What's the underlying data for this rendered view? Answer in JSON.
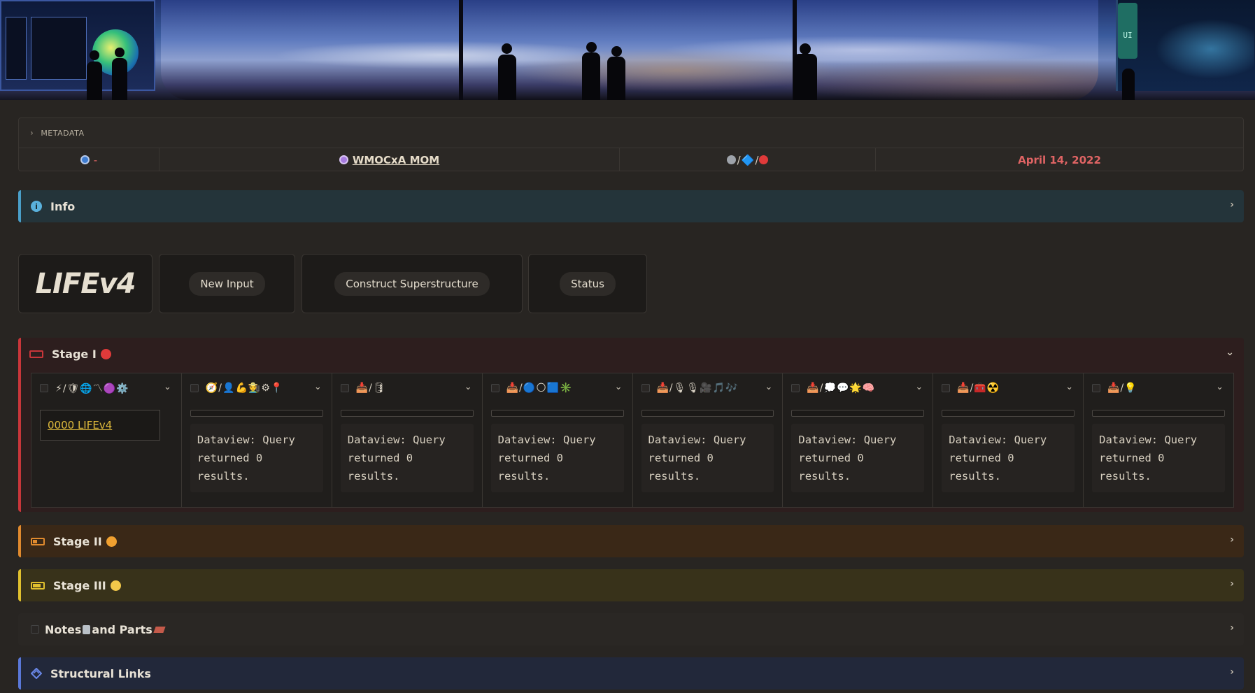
{
  "metadata": {
    "label": "METADATA",
    "cell1_text": "-",
    "cell2_link": "WMOCxA MOM",
    "cell3_glyphs": "/🔷/",
    "date": "April 14, 2022"
  },
  "info": {
    "label": "Info"
  },
  "buttons": {
    "title": "LIFEv4",
    "new_input": "New Input",
    "construct": "Construct Superstructure",
    "status": "Status"
  },
  "stage1": {
    "label": "Stage I",
    "first_link": "0000 LIFEv4",
    "dataview_msg": "Dataview: Query returned 0 results.",
    "columns": [
      {
        "glyphs": "⚡/🛡🌐〽🟣⚙️"
      },
      {
        "glyphs": "🧭/👤💪🧑‍🌾⚙📍"
      },
      {
        "glyphs": "📥/🛢"
      },
      {
        "glyphs": "📥/🔵🌕🟦✳️"
      },
      {
        "glyphs": "📥/🎙🎙🎥🎵🎶"
      },
      {
        "glyphs": "📥/💭💬🌟🧠"
      },
      {
        "glyphs": "📥/🧰☢️"
      },
      {
        "glyphs": "📥/💡"
      }
    ]
  },
  "stage2": {
    "label": "Stage II"
  },
  "stage3": {
    "label": "Stage III"
  },
  "notes": {
    "label_a": "Notes",
    "label_b": " and Parts"
  },
  "links": {
    "label": "Structural Links"
  },
  "colors": {
    "stage1": "#c9363a",
    "stage2": "#e08a2e",
    "stage3": "#e0c02e",
    "info": "#4a9fc9",
    "links": "#5a78d8",
    "date": "#e06464"
  }
}
